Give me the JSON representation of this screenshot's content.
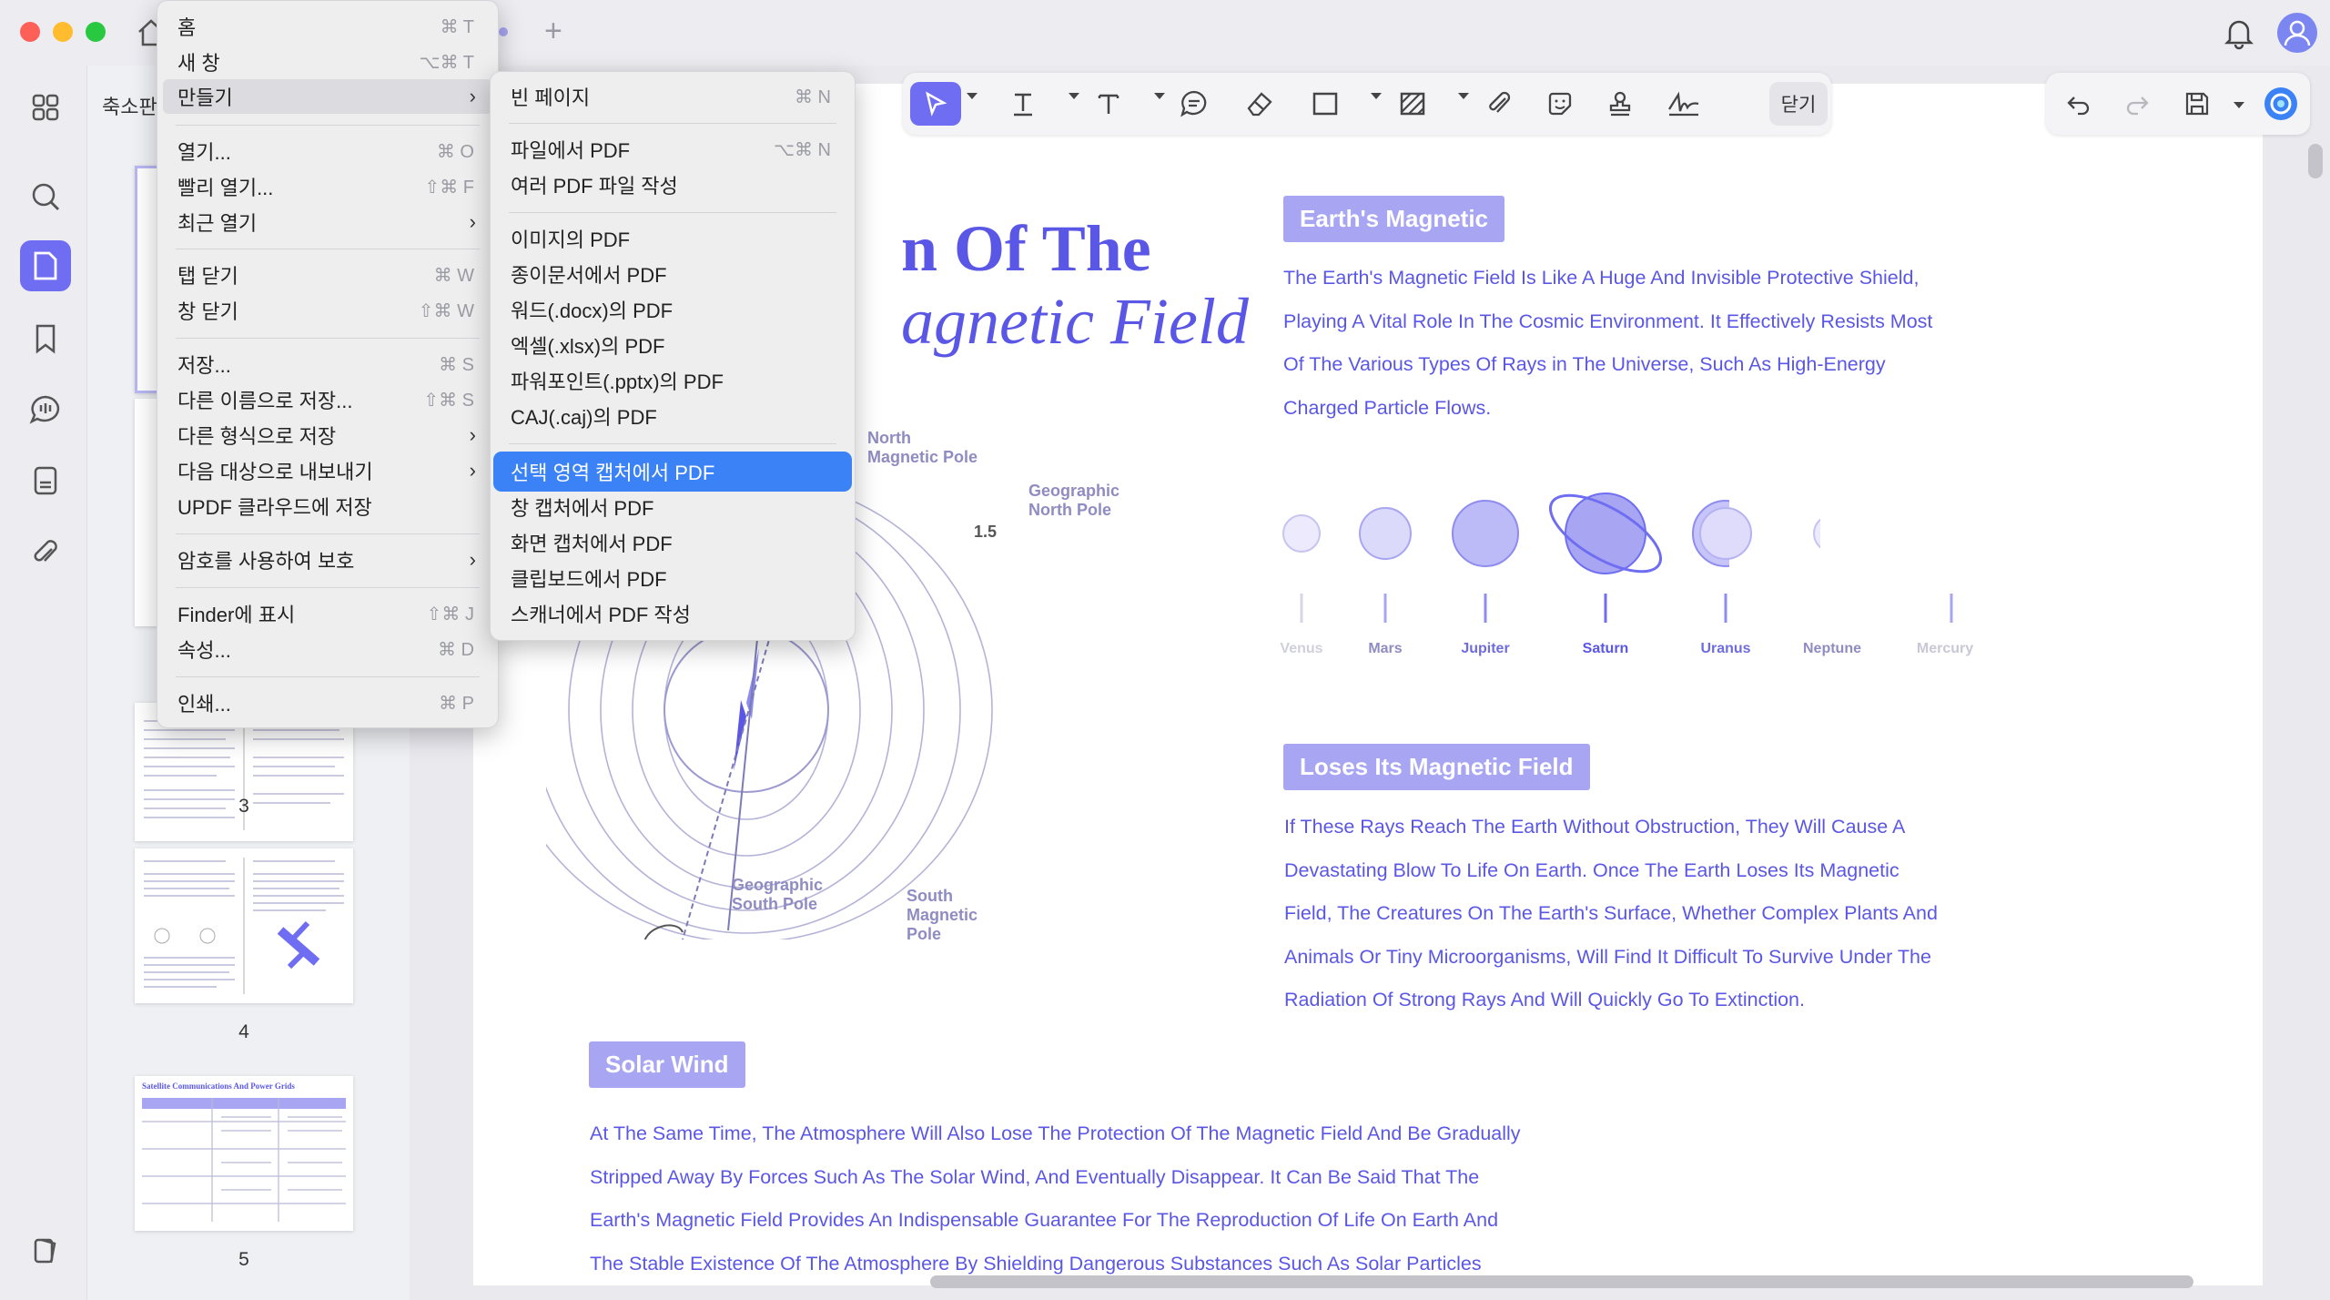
{
  "window": {
    "tab_plus": "+"
  },
  "thumbnails": {
    "title": "축소판",
    "pages": [
      "3",
      "4",
      "5"
    ],
    "thumb5_heading": "Satellite Communications And Power Grids"
  },
  "toolbar": {
    "close_label": "닫기"
  },
  "file_menu": {
    "items": [
      {
        "label": "홈",
        "shortcut": "⌘ T"
      },
      {
        "label": "새 창",
        "shortcut": "⌥⌘ T"
      },
      {
        "label": "만들기",
        "arrow": "›"
      },
      {
        "label": "열기...",
        "shortcut": "⌘ O"
      },
      {
        "label": "빨리 열기...",
        "shortcut": "⇧⌘ F"
      },
      {
        "label": "최근 열기",
        "arrow": "›"
      },
      {
        "label": "탭 닫기",
        "shortcut": "⌘ W"
      },
      {
        "label": "창 닫기",
        "shortcut": "⇧⌘ W"
      },
      {
        "label": "저장...",
        "shortcut": "⌘ S"
      },
      {
        "label": "다른 이름으로 저장...",
        "shortcut": "⇧⌘ S"
      },
      {
        "label": "다른 형식으로 저장",
        "arrow": "›"
      },
      {
        "label": "다음 대상으로 내보내기",
        "arrow": "›"
      },
      {
        "label": "UPDF 클라우드에 저장"
      },
      {
        "label": "암호를 사용하여 보호",
        "arrow": "›"
      },
      {
        "label": "Finder에 표시",
        "shortcut": "⇧⌘ J"
      },
      {
        "label": "속성...",
        "shortcut": "⌘ D"
      },
      {
        "label": "인쇄...",
        "shortcut": "⌘ P"
      }
    ]
  },
  "create_submenu": {
    "items": [
      {
        "label": "빈 페이지",
        "shortcut": "⌘ N"
      },
      {
        "label": "파일에서 PDF",
        "shortcut": "⌥⌘ N"
      },
      {
        "label": "여러 PDF 파일 작성"
      },
      {
        "label": "이미지의 PDF"
      },
      {
        "label": "종이문서에서 PDF"
      },
      {
        "label": "워드(.docx)의 PDF"
      },
      {
        "label": "엑셀(.xlsx)의 PDF"
      },
      {
        "label": "파워포인트(.pptx)의 PDF"
      },
      {
        "label": "CAJ(.caj)의 PDF"
      },
      {
        "label": "선택 영역 캡처에서 PDF"
      },
      {
        "label": "창 캡처에서 PDF"
      },
      {
        "label": "화면 캡처에서 PDF"
      },
      {
        "label": "클립보드에서 PDF"
      },
      {
        "label": "스캐너에서 PDF 작성"
      }
    ]
  },
  "document": {
    "title_line1": "n Of The",
    "title_line2": "agnetic Field",
    "section1": {
      "heading": "Earth's Magnetic",
      "lines": [
        "The Earth's Magnetic Field Is Like A Huge And Invisible Protective Shield,",
        "Playing A Vital Role In The Cosmic Environment. It Effectively Resists Most",
        "Of The Various Types Of Rays in The Universe, Such As High-Energy",
        "Charged Particle Flows."
      ]
    },
    "planets": [
      "Venus",
      "Mars",
      "Jupiter",
      "Saturn",
      "Uranus",
      "Neptune",
      "Mercury"
    ],
    "section2": {
      "heading": "Loses Its Magnetic Field",
      "lines": [
        "If These Rays Reach The Earth Without Obstruction, They Will Cause A",
        "Devastating Blow To Life On Earth. Once The Earth Loses Its Magnetic",
        "Field, The Creatures On The Earth's Surface, Whether Complex Plants And",
        "Animals Or Tiny Microorganisms, Will Find It Difficult To Survive Under The",
        "Radiation Of Strong Rays And Will Quickly Go To Extinction."
      ]
    },
    "section3": {
      "heading": "Solar Wind",
      "lines": [
        "At The Same Time, The Atmosphere Will Also Lose The Protection Of The Magnetic Field And Be Gradually",
        "Stripped Away By Forces Such As The Solar Wind, And Eventually Disappear. It Can Be Said That The",
        "Earth's Magnetic Field Provides An Indispensable Guarantee For The Reproduction Of Life On Earth And",
        "The Stable Existence Of The Atmosphere By Shielding Dangerous Substances Such As Solar Particles"
      ]
    },
    "diagram": {
      "north_magnetic_pole": [
        "North",
        "Magnetic Pole"
      ],
      "geographic_north_pole": [
        "Geographic",
        "North Pole"
      ],
      "geographic_south_pole": [
        "Geographic",
        "South Pole"
      ],
      "south_magnetic_pole": [
        "South",
        "Magnetic",
        "Pole"
      ],
      "angle": "1.5"
    }
  },
  "colors": {
    "accent": "#6f6ef2",
    "doc_text": "#5b57e6",
    "badge": "#a8a6f3",
    "menu_selected": "#3b82f6"
  }
}
